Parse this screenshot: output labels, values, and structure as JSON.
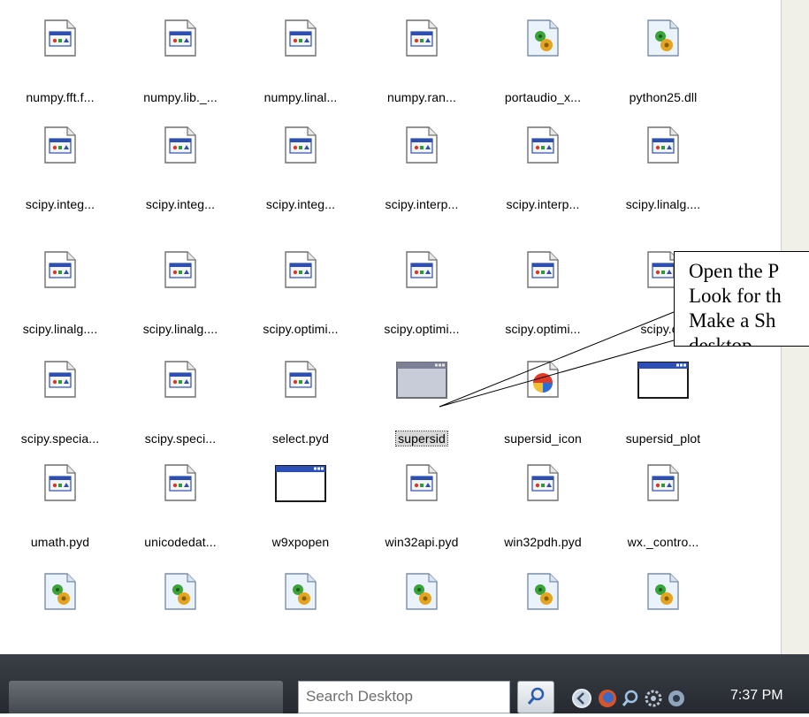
{
  "desktop": {
    "icons": [
      {
        "label": "numpy.fft.f...",
        "type": "pyd"
      },
      {
        "label": "numpy.lib._...",
        "type": "pyd"
      },
      {
        "label": "numpy.linal...",
        "type": "pyd"
      },
      {
        "label": "numpy.ran...",
        "type": "pyd"
      },
      {
        "label": "portaudio_x...",
        "type": "dll"
      },
      {
        "label": "python25.dll",
        "type": "dll"
      },
      {
        "label": "scipy.integ...",
        "type": "pyd"
      },
      {
        "label": "scipy.integ...",
        "type": "pyd"
      },
      {
        "label": "scipy.integ...",
        "type": "pyd"
      },
      {
        "label": "scipy.interp...",
        "type": "pyd"
      },
      {
        "label": "scipy.interp...",
        "type": "pyd"
      },
      {
        "label": "scipy.linalg....",
        "type": "pyd"
      },
      {
        "label": "scipy.linalg....",
        "type": "pyd"
      },
      {
        "label": "scipy.linalg....",
        "type": "pyd"
      },
      {
        "label": "scipy.optimi...",
        "type": "pyd"
      },
      {
        "label": "scipy.optimi...",
        "type": "pyd"
      },
      {
        "label": "scipy.optimi...",
        "type": "pyd"
      },
      {
        "label": "scipy.op",
        "type": "pyd"
      },
      {
        "label": "scipy.specia...",
        "type": "pyd"
      },
      {
        "label": "scipy.speci...",
        "type": "pyd"
      },
      {
        "label": "select.pyd",
        "type": "pyd"
      },
      {
        "label": "supersid",
        "type": "exe-selected"
      },
      {
        "label": "supersid_icon",
        "type": "ico"
      },
      {
        "label": "supersid_plot",
        "type": "exe"
      },
      {
        "label": "umath.pyd",
        "type": "pyd"
      },
      {
        "label": "unicodedat...",
        "type": "pyd"
      },
      {
        "label": "w9xpopen",
        "type": "exe"
      },
      {
        "label": "win32api.pyd",
        "type": "pyd"
      },
      {
        "label": "win32pdh.pyd",
        "type": "pyd"
      },
      {
        "label": "wx._contro...",
        "type": "pyd"
      },
      {
        "label": "",
        "type": "dll"
      },
      {
        "label": "",
        "type": "dll"
      },
      {
        "label": "",
        "type": "dll"
      },
      {
        "label": "",
        "type": "dll"
      },
      {
        "label": "",
        "type": "dll"
      },
      {
        "label": "",
        "type": "dll"
      }
    ]
  },
  "annotation": {
    "lines": [
      "Open the P",
      "Look for th",
      "Make a Sh",
      "desktop"
    ]
  },
  "taskbar": {
    "search_placeholder": "Search Desktop",
    "clock": "7:37 PM"
  }
}
